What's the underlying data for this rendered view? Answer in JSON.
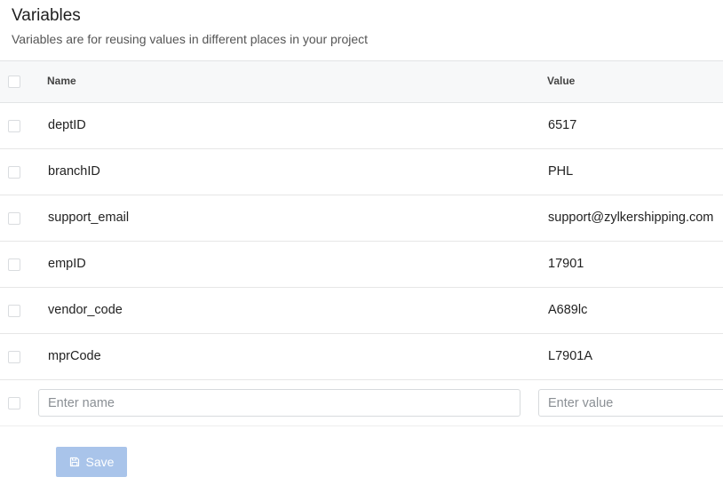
{
  "page": {
    "title": "Variables",
    "subtitle": "Variables are for reusing values in different places in your project"
  },
  "table": {
    "columns": {
      "name": "Name",
      "value": "Value"
    },
    "rows": [
      {
        "name": "deptID",
        "value": "6517"
      },
      {
        "name": "branchID",
        "value": "PHL"
      },
      {
        "name": "support_email",
        "value": "support@zylkershipping.com"
      },
      {
        "name": "empID",
        "value": "17901"
      },
      {
        "name": "vendor_code",
        "value": "A689lc"
      },
      {
        "name": "mprCode",
        "value": "L7901A"
      }
    ],
    "new_row": {
      "name_placeholder": "Enter name",
      "value_placeholder": "Enter value",
      "name_value": "",
      "value_value": ""
    }
  },
  "actions": {
    "save_label": "Save",
    "save_icon": "floppy-disk-icon",
    "save_enabled": false
  },
  "colors": {
    "save_button_bg": "#a9c4ea",
    "header_bg": "#f7f8f9"
  }
}
